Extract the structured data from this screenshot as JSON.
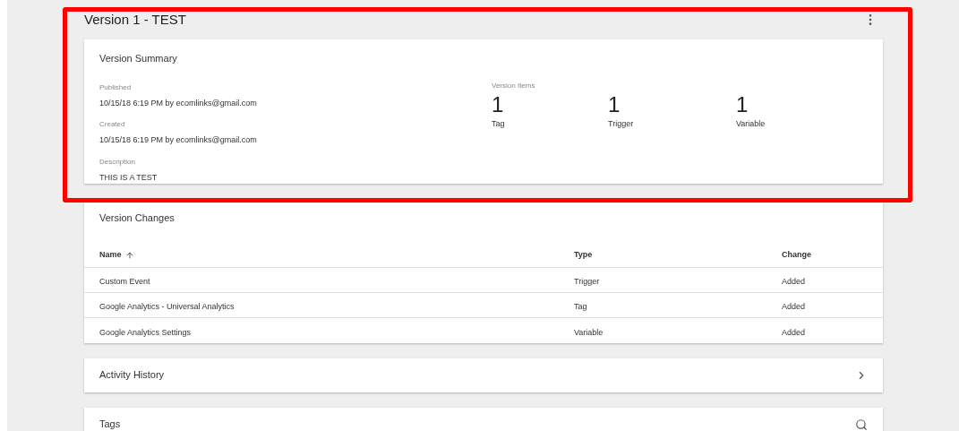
{
  "title": "Version 1 - TEST",
  "summary": {
    "heading": "Version Summary",
    "fields": [
      {
        "label": "Published",
        "value": "10/15/18 6:19 PM by ecomlinks@gmail.com"
      },
      {
        "label": "Created",
        "value": "10/15/18 6:19 PM by ecomlinks@gmail.com"
      },
      {
        "label": "Description",
        "value": "THIS IS A TEST"
      }
    ],
    "items_label": "Version Items",
    "items": [
      {
        "count": "1",
        "label": "Tag"
      },
      {
        "count": "1",
        "label": "Trigger"
      },
      {
        "count": "1",
        "label": "Variable"
      }
    ]
  },
  "changes": {
    "heading": "Version Changes",
    "columns": [
      {
        "label": "Name",
        "sorted": true
      },
      {
        "label": "Type",
        "sorted": false
      },
      {
        "label": "Change",
        "sorted": false
      }
    ],
    "rows": [
      [
        "Custom Event",
        "Trigger",
        "Added"
      ],
      [
        "Google Analytics - Universal Analytics",
        "Tag",
        "Added"
      ],
      [
        "Google Analytics Settings",
        "Variable",
        "Added"
      ]
    ]
  },
  "sections": [
    {
      "title": "Activity History",
      "kind": "expand"
    },
    {
      "title": "Tags",
      "kind": "search"
    }
  ]
}
